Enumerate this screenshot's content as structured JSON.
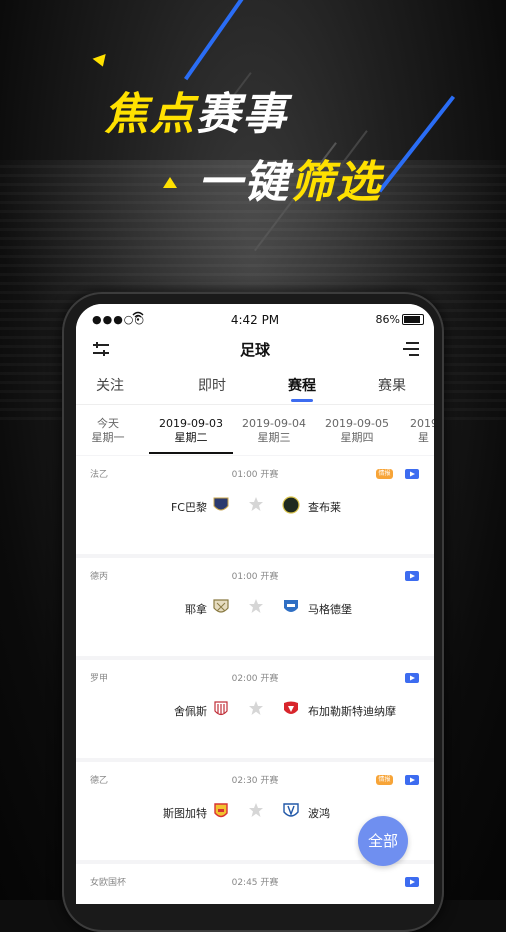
{
  "promo": {
    "headline_1a": "焦点",
    "headline_1b": "赛事",
    "headline_2a": "一键",
    "headline_2b": "筛选",
    "accent_yellow": "#ffe100",
    "accent_blue": "#2a6df5"
  },
  "status_bar": {
    "signal": "●●●○○",
    "time": "4:42 PM",
    "battery": "86%"
  },
  "navbar": {
    "title": "足球",
    "left_icon": "filter-sliders-icon",
    "right_icon": "menu-lines-icon"
  },
  "tabs": [
    {
      "label": "关注",
      "active": false
    },
    {
      "label": "即时",
      "active": false
    },
    {
      "label": "赛程",
      "active": true
    },
    {
      "label": "赛果",
      "active": false
    }
  ],
  "dates": [
    {
      "date": "今天",
      "weekday": "星期一",
      "active": false
    },
    {
      "date": "2019-09-03",
      "weekday": "星期二",
      "active": true
    },
    {
      "date": "2019-09-04",
      "weekday": "星期三",
      "active": false
    },
    {
      "date": "2019-09-05",
      "weekday": "星期四",
      "active": false
    },
    {
      "date": "2019",
      "weekday": "星",
      "active": false
    }
  ],
  "matches": [
    {
      "league": "法乙",
      "time": "01:00 开赛",
      "home": "FC巴黎",
      "away": "查布莱",
      "hot": true,
      "home_color": "#2b3a6e",
      "away_color": "#1f2a1f"
    },
    {
      "league": "德丙",
      "time": "01:00 开赛",
      "home": "耶拿",
      "away": "马格德堡",
      "hot": false,
      "home_color": "#8a7b44",
      "away_color": "#2f6fc4"
    },
    {
      "league": "罗甲",
      "time": "02:00 开赛",
      "home": "舍佩斯",
      "away": "布加勒斯特迪纳摩",
      "hot": false,
      "home_color": "#c0303a",
      "away_color": "#d8252c"
    },
    {
      "league": "德乙",
      "time": "02:30 开赛",
      "home": "斯图加特",
      "away": "波鸿",
      "hot": true,
      "home_color": "#d83232",
      "away_color": "#2258a8"
    },
    {
      "league": "女欧国杯",
      "time": "02:45 开赛",
      "home": "",
      "away": "",
      "hot": false,
      "home_color": "#999999",
      "away_color": "#999999"
    }
  ],
  "hot_label": "情报",
  "fab_label": "全部"
}
